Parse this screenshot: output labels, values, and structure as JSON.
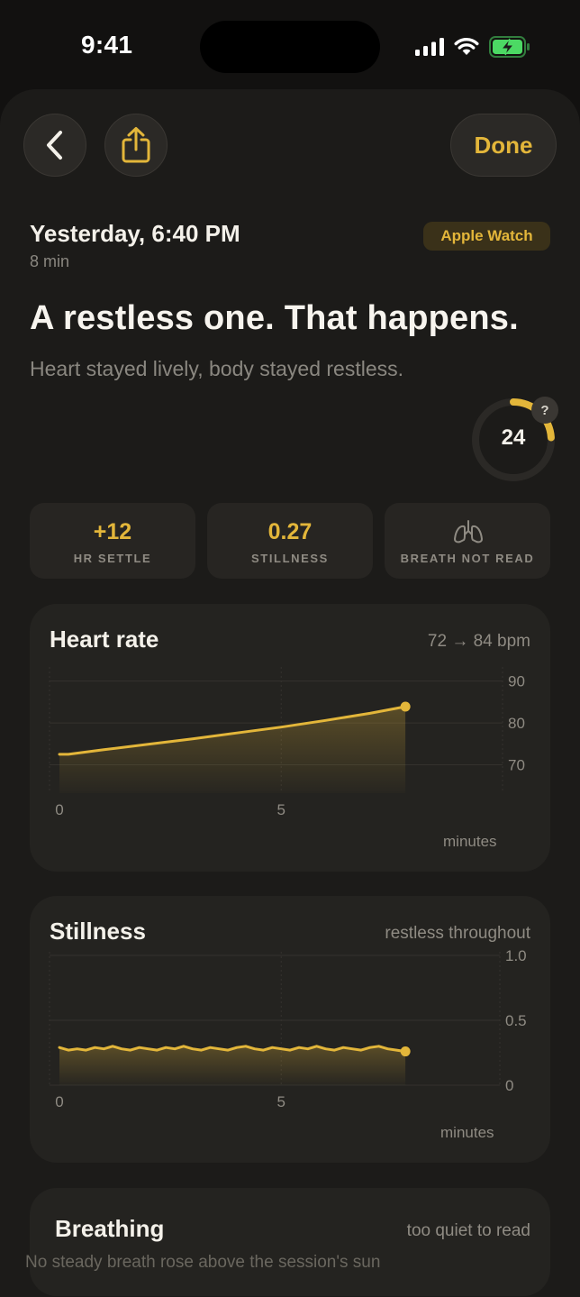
{
  "status_bar": {
    "time": "9:41"
  },
  "toolbar": {
    "done_label": "Done"
  },
  "session": {
    "date": "Yesterday, 6:40 PM",
    "duration": "8 min",
    "source": "Apple Watch",
    "headline": "A restless one. That happens.",
    "summary": "Heart stayed lively, body stayed restless.",
    "score": "24",
    "score_fraction": 0.24,
    "score_help": "?"
  },
  "stats": [
    {
      "value": "+12",
      "label": "HR SETTLE"
    },
    {
      "value": "0.27",
      "label": "STILLNESS"
    },
    {
      "value": "",
      "label": "BREATH NOT READ",
      "icon": "lungs-icon"
    }
  ],
  "heart_card": {
    "title": "Heart rate",
    "summary": "72 → 84 bpm",
    "x_label": "minutes"
  },
  "stillness_card": {
    "title": "Stillness",
    "summary": "restless throughout",
    "x_label": "minutes"
  },
  "breathing_card": {
    "title": "Breathing",
    "summary": "too quiet to read",
    "body": "No steady breath rose above the session's sun"
  },
  "colors": {
    "accent": "#e3b63a",
    "background": "#121110",
    "card": "#242320"
  },
  "chart_data": [
    {
      "type": "area",
      "title": "Heart rate",
      "xlabel": "minutes",
      "x_ticks": [
        0,
        5
      ],
      "y_ticks": [
        70,
        80,
        90
      ],
      "xlim": [
        0,
        8
      ],
      "ylim": [
        63,
        91
      ],
      "series": [
        {
          "x": [
            0,
            0.2,
            1,
            2,
            3,
            4,
            5,
            6,
            7,
            7.8
          ],
          "y": [
            72.5,
            72.5,
            73.6,
            74.9,
            76.2,
            77.6,
            79.0,
            80.6,
            82.3,
            83.9
          ]
        }
      ]
    },
    {
      "type": "area",
      "title": "Stillness",
      "xlabel": "minutes",
      "x_ticks": [
        0,
        5
      ],
      "y_ticks": [
        "0",
        "0.5",
        "1.0"
      ],
      "xlim": [
        0,
        8
      ],
      "ylim": [
        0,
        1.0
      ],
      "series": [
        {
          "x": [
            0,
            0.2,
            0.4,
            0.6,
            0.8,
            1.0,
            1.2,
            1.4,
            1.6,
            1.8,
            2.0,
            2.2,
            2.4,
            2.6,
            2.8,
            3.0,
            3.2,
            3.4,
            3.6,
            3.8,
            4.0,
            4.2,
            4.4,
            4.6,
            4.8,
            5.0,
            5.2,
            5.4,
            5.6,
            5.8,
            6.0,
            6.2,
            6.4,
            6.6,
            6.8,
            7.0,
            7.2,
            7.4,
            7.6,
            7.8
          ],
          "y": [
            0.29,
            0.27,
            0.28,
            0.27,
            0.29,
            0.28,
            0.3,
            0.28,
            0.27,
            0.29,
            0.28,
            0.27,
            0.29,
            0.28,
            0.3,
            0.28,
            0.27,
            0.29,
            0.28,
            0.27,
            0.29,
            0.3,
            0.28,
            0.27,
            0.29,
            0.28,
            0.27,
            0.29,
            0.28,
            0.3,
            0.28,
            0.27,
            0.29,
            0.28,
            0.27,
            0.29,
            0.3,
            0.28,
            0.27,
            0.26
          ]
        }
      ]
    }
  ]
}
